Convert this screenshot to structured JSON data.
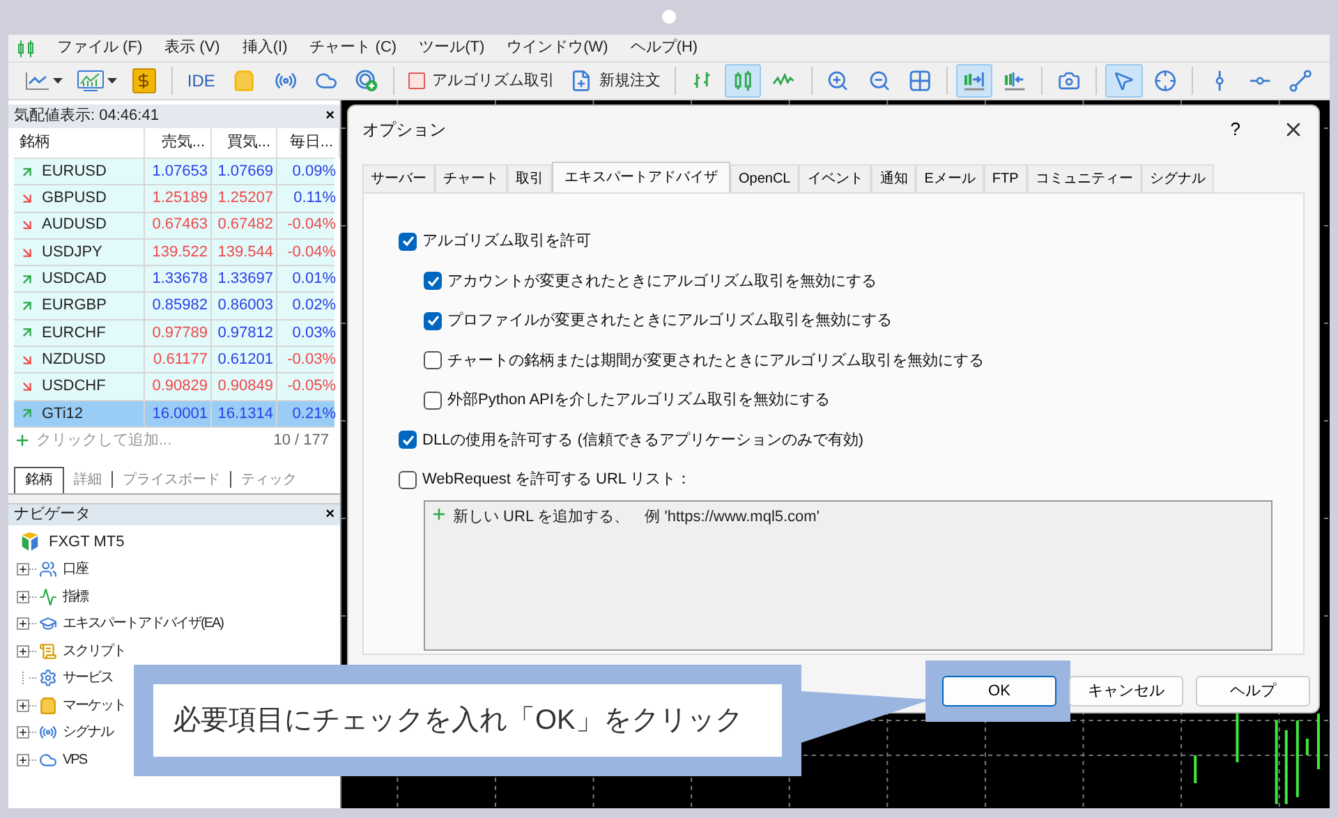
{
  "menu": [
    {
      "label": "ファイル (F)"
    },
    {
      "label": "表示 (V)"
    },
    {
      "label": "挿入(I)"
    },
    {
      "label": "チャート (C)"
    },
    {
      "label": "ツール(T)"
    },
    {
      "label": "ウインドウ(W)"
    },
    {
      "label": "ヘルプ(H)"
    }
  ],
  "toolbar": [
    {
      "kind": "icon",
      "active": false
    },
    {
      "kind": "icon",
      "active": false
    },
    {
      "kind": "icon",
      "active": false
    },
    {
      "kind": "separator"
    },
    {
      "kind": "text",
      "label": "IDE"
    },
    {
      "kind": "icon",
      "active": false
    },
    {
      "kind": "icon",
      "active": false
    },
    {
      "kind": "icon",
      "active": false
    },
    {
      "kind": "icon",
      "active": false
    },
    {
      "kind": "separator"
    },
    {
      "kind": "labeled",
      "label": "アルゴリズム取引"
    },
    {
      "kind": "labeled",
      "label": "新規注文"
    },
    {
      "kind": "separator"
    },
    {
      "kind": "icon",
      "active": false
    },
    {
      "kind": "icon",
      "active": true
    },
    {
      "kind": "icon",
      "active": false
    },
    {
      "kind": "separator"
    },
    {
      "kind": "icon",
      "active": false
    },
    {
      "kind": "icon",
      "active": false
    },
    {
      "kind": "icon",
      "active": false
    },
    {
      "kind": "separator"
    },
    {
      "kind": "icon",
      "active": true
    },
    {
      "kind": "icon",
      "active": false
    },
    {
      "kind": "separator"
    },
    {
      "kind": "icon",
      "active": false
    },
    {
      "kind": "separator"
    },
    {
      "kind": "icon",
      "active": true
    },
    {
      "kind": "icon",
      "active": false
    },
    {
      "kind": "separator"
    },
    {
      "kind": "icon",
      "active": false
    },
    {
      "kind": "icon",
      "active": false
    },
    {
      "kind": "icon",
      "active": false
    }
  ],
  "quotes": {
    "title": "気配値表示: 04:46:41",
    "close": "×",
    "columns": [
      "銘柄",
      "売気...",
      "買気...",
      "毎日..."
    ],
    "rows": [
      {
        "symbol": "EURUSD",
        "rising": true,
        "bid": "1.07653",
        "bid_rising": true,
        "ask": "1.07669",
        "ask_rising": true,
        "change": "0.09%",
        "change_rising": true,
        "selected": false
      },
      {
        "symbol": "GBPUSD",
        "rising": false,
        "bid": "1.25189",
        "bid_rising": false,
        "ask": "1.25207",
        "ask_rising": false,
        "change": "0.11%",
        "change_rising": true,
        "selected": false
      },
      {
        "symbol": "AUDUSD",
        "rising": false,
        "bid": "0.67463",
        "bid_rising": false,
        "ask": "0.67482",
        "ask_rising": false,
        "change": "-0.04%",
        "change_rising": false,
        "selected": false
      },
      {
        "symbol": "USDJPY",
        "rising": false,
        "bid": "139.522",
        "bid_rising": false,
        "ask": "139.544",
        "ask_rising": false,
        "change": "-0.04%",
        "change_rising": false,
        "selected": false
      },
      {
        "symbol": "USDCAD",
        "rising": true,
        "bid": "1.33678",
        "bid_rising": true,
        "ask": "1.33697",
        "ask_rising": true,
        "change": "0.01%",
        "change_rising": true,
        "selected": false
      },
      {
        "symbol": "EURGBP",
        "rising": true,
        "bid": "0.85982",
        "bid_rising": true,
        "ask": "0.86003",
        "ask_rising": true,
        "change": "0.02%",
        "change_rising": true,
        "selected": false
      },
      {
        "symbol": "EURCHF",
        "rising": true,
        "bid": "0.97789",
        "bid_rising": false,
        "ask": "0.97812",
        "ask_rising": true,
        "change": "0.03%",
        "change_rising": true,
        "selected": false
      },
      {
        "symbol": "NZDUSD",
        "rising": false,
        "bid": "0.61177",
        "bid_rising": false,
        "ask": "0.61201",
        "ask_rising": true,
        "change": "-0.03%",
        "change_rising": false,
        "selected": false
      },
      {
        "symbol": "USDCHF",
        "rising": false,
        "bid": "0.90829",
        "bid_rising": false,
        "ask": "0.90849",
        "ask_rising": false,
        "change": "-0.05%",
        "change_rising": false,
        "selected": false
      },
      {
        "symbol": "GTi12",
        "rising": true,
        "bid": "16.0001",
        "bid_rising": true,
        "ask": "16.1314",
        "ask_rising": true,
        "change": "0.21%",
        "change_rising": true,
        "selected": true
      }
    ],
    "add_label": "クリックして追加...",
    "count": "10 / 177",
    "tabs": [
      {
        "label": "銘柄",
        "selected": true
      },
      {
        "label": "詳細",
        "selected": false
      },
      {
        "label": "プライスボード",
        "selected": false
      },
      {
        "label": "ティック",
        "selected": false
      }
    ]
  },
  "navigator": {
    "title": "ナビゲータ",
    "close": "×",
    "root": "FXGT MT5",
    "items": [
      {
        "label": "口座",
        "expandable": true
      },
      {
        "label": "指標",
        "expandable": true
      },
      {
        "label": "エキスパートアドバイザ(EA)",
        "expandable": true
      },
      {
        "label": "スクリプト",
        "expandable": true
      },
      {
        "label": "サービス",
        "expandable": false
      },
      {
        "label": "マーケット",
        "expandable": true
      },
      {
        "label": "シグナル",
        "expandable": true
      },
      {
        "label": "VPS",
        "expandable": true
      }
    ]
  },
  "dialog": {
    "title": "オプション",
    "help": "?",
    "tabs": [
      {
        "label": "サーバー",
        "selected": false
      },
      {
        "label": "チャート",
        "selected": false
      },
      {
        "label": "取引",
        "selected": false
      },
      {
        "label": "エキスパートアドバイザ",
        "selected": true
      },
      {
        "label": "OpenCL",
        "selected": false
      },
      {
        "label": "イベント",
        "selected": false
      },
      {
        "label": "通知",
        "selected": false
      },
      {
        "label": "Eメール",
        "selected": false
      },
      {
        "label": "FTP",
        "selected": false
      },
      {
        "label": "コミュニティー",
        "selected": false
      },
      {
        "label": "シグナル",
        "selected": false
      }
    ],
    "options": [
      {
        "label": "アルゴリズム取引を許可",
        "checked": true,
        "children": [
          {
            "label": "アカウントが変更されたときにアルゴリズム取引を無効にする",
            "checked": true
          },
          {
            "label": "プロファイルが変更されたときにアルゴリズム取引を無効にする",
            "checked": true
          },
          {
            "label": "チャートの銘柄または期間が変更されたときにアルゴリズム取引を無効にする",
            "checked": false
          },
          {
            "label": "外部Python APIを介したアルゴリズム取引を無効にする",
            "checked": false
          }
        ]
      },
      {
        "label": "DLLの使用を許可する (信頼できるアプリケーションのみで有効)",
        "checked": true
      },
      {
        "label": "WebRequest を許可する URL リスト：",
        "checked": false
      }
    ],
    "url_list": {
      "add_label": "新しい URL を追加する、　例 'https://www.mql5.com'"
    },
    "buttons": [
      {
        "label": "OK",
        "highlighted": true
      },
      {
        "label": "キャンセル",
        "highlighted": false
      },
      {
        "label": "ヘルプ",
        "highlighted": false
      }
    ]
  },
  "callout": {
    "text": "必要項目にチェックを入れ「OK」をクリック"
  }
}
